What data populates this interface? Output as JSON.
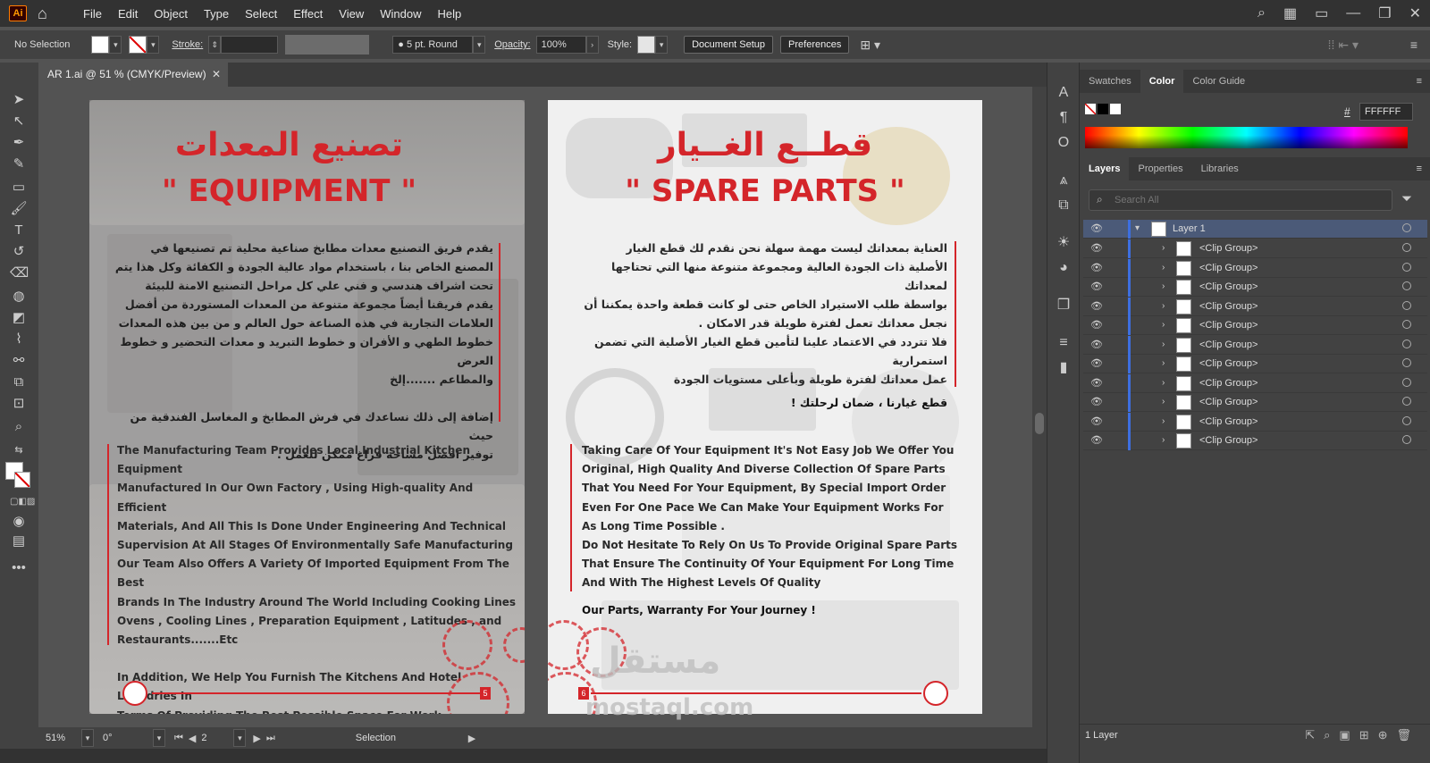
{
  "app": {
    "logo": "Ai",
    "menus": [
      "File",
      "Edit",
      "Object",
      "Type",
      "Select",
      "Effect",
      "View",
      "Window",
      "Help"
    ]
  },
  "control": {
    "selection": "No Selection",
    "stroke_label": "Stroke:",
    "brush": "5 pt. Round",
    "opacity_label": "Opacity:",
    "opacity": "100%",
    "style_label": "Style:",
    "doc_setup": "Document Setup",
    "preferences": "Preferences"
  },
  "document": {
    "tab_title": "AR 1.ai @ 51 % (CMYK/Preview)",
    "close": "✕"
  },
  "status": {
    "zoom": "51%",
    "rotation": "0°",
    "page": "2",
    "tool": "Selection"
  },
  "panels": {
    "top_tabs": [
      "Swatches",
      "Color",
      "Color Guide"
    ],
    "hex_label": "#",
    "hex_value": "FFFFFF",
    "layer_tabs": [
      "Layers",
      "Properties",
      "Libraries"
    ],
    "search_placeholder": "Search All",
    "layer_name": "Layer 1",
    "clip_groups": [
      "<Clip Group>",
      "<Clip Group>",
      "<Clip Group>",
      "<Clip Group>",
      "<Clip Group>",
      "<Clip Group>",
      "<Clip Group>",
      "<Clip Group>",
      "<Clip Group>",
      "<Clip Group>",
      "<Clip Group>"
    ],
    "layer_count": "1 Layer"
  },
  "artboard_left": {
    "title_ar": "تصنيع المعدات",
    "title_en": "\" EQUIPMENT \"",
    "ar_lines": [
      "يقدم فريق التصنيع معدات مطابخ صناعية محلية تم تصنيعها في",
      "المصنع الخاص بنا ، باستخدام مواد عالية الجودة و الكفائة وكل هذا يتم",
      "تحت اشراف هندسي و فني علي كل مراحل التصنيع الامنة للبيئة",
      "يقدم فريقنا أيضاً مجموعة متنوعة من المعدات المستوردة من أفضل",
      "العلامات التجارية في هذه الصناعة حول العالم و من بين هذه المعدات",
      "خطوط الطهي و الأفران و خطوط التبريد و معدات التحضير و خطوط العرض",
      "والمطاعم .......إلخ",
      "",
      "إضافة إلى ذلك نساعدك في فرش المطابخ و المغاسل الفندقية من حيث",
      "توفير افضل مساحة فراغ ممكن للعمل ."
    ],
    "en_lines": [
      "The Manufacturing Team Provides Local Industrial Kitchen Equipment",
      "Manufactured In Our Own Factory , Using High-quality And Efficient",
      "Materials, And All This Is Done Under Engineering And Technical",
      "Supervision At All Stages Of Environmentally Safe Manufacturing",
      "Our Team Also Offers A Variety Of Imported Equipment From The Best",
      "Brands In The Industry Around The World Including Cooking Lines",
      "Ovens , Cooling Lines , Preparation Equipment , Latitudes , and",
      "Restaurants.......Etc",
      "",
      "In Addition, We Help You Furnish The Kitchens And Hotel Laundries In",
      "Terms Of Providing The Best Possible Space For Work ."
    ],
    "page_num": "5"
  },
  "artboard_right": {
    "title_ar": "قطــع الغــيار",
    "title_en": "\" SPARE PARTS \"",
    "ar_lines": [
      "العناية بمعداتك ليست مهمة سهلة نحن نقدم لك قطع الغيار",
      "الأصلية ذات الجودة العالية ومجموعة متنوعة منها التي تحتاجها لمعداتك",
      "بواسطة طلب الاستيراد الخاص حتى لو كانت قطعة واحدة يمكننا أن",
      "نجعل معداتك تعمل لفترة طويلة قدر الامكان .",
      "فلا تتردد في الاعتماد علينا لتأمين قطع الغيار الأصلية التي تضمن استمرارية",
      "عمل معداتك لفترة طويلة وبأعلى مستويات الجودة"
    ],
    "ar_slogan": "قطع غيارنا ، ضمان لرحلتك !",
    "en_lines": [
      "Taking Care Of Your Equipment It's Not Easy Job We Offer You",
      "Original, High Quality And Diverse Collection Of Spare Parts",
      "That You Need For  Your Equipment, By Special Import Order",
      "Even For One Pace We Can Make Your Equipment  Works For",
      "As Long Time Possible .",
      "Do Not Hesitate To Rely On Us To Provide Original Spare Parts",
      "That Ensure The Continuity Of Your Equipment For Long Time",
      "And With The Highest Levels Of Quality"
    ],
    "en_slogan": "Our Parts, Warranty For Your Journey !",
    "page_num": "6"
  },
  "watermark": {
    "ar": "مستقل",
    "en": "mostaql.com"
  },
  "colors": {
    "accent": "#d4252a",
    "ui_dark": "#323232",
    "ui_panel": "#424242",
    "layer_blue": "#3d6fe0"
  }
}
